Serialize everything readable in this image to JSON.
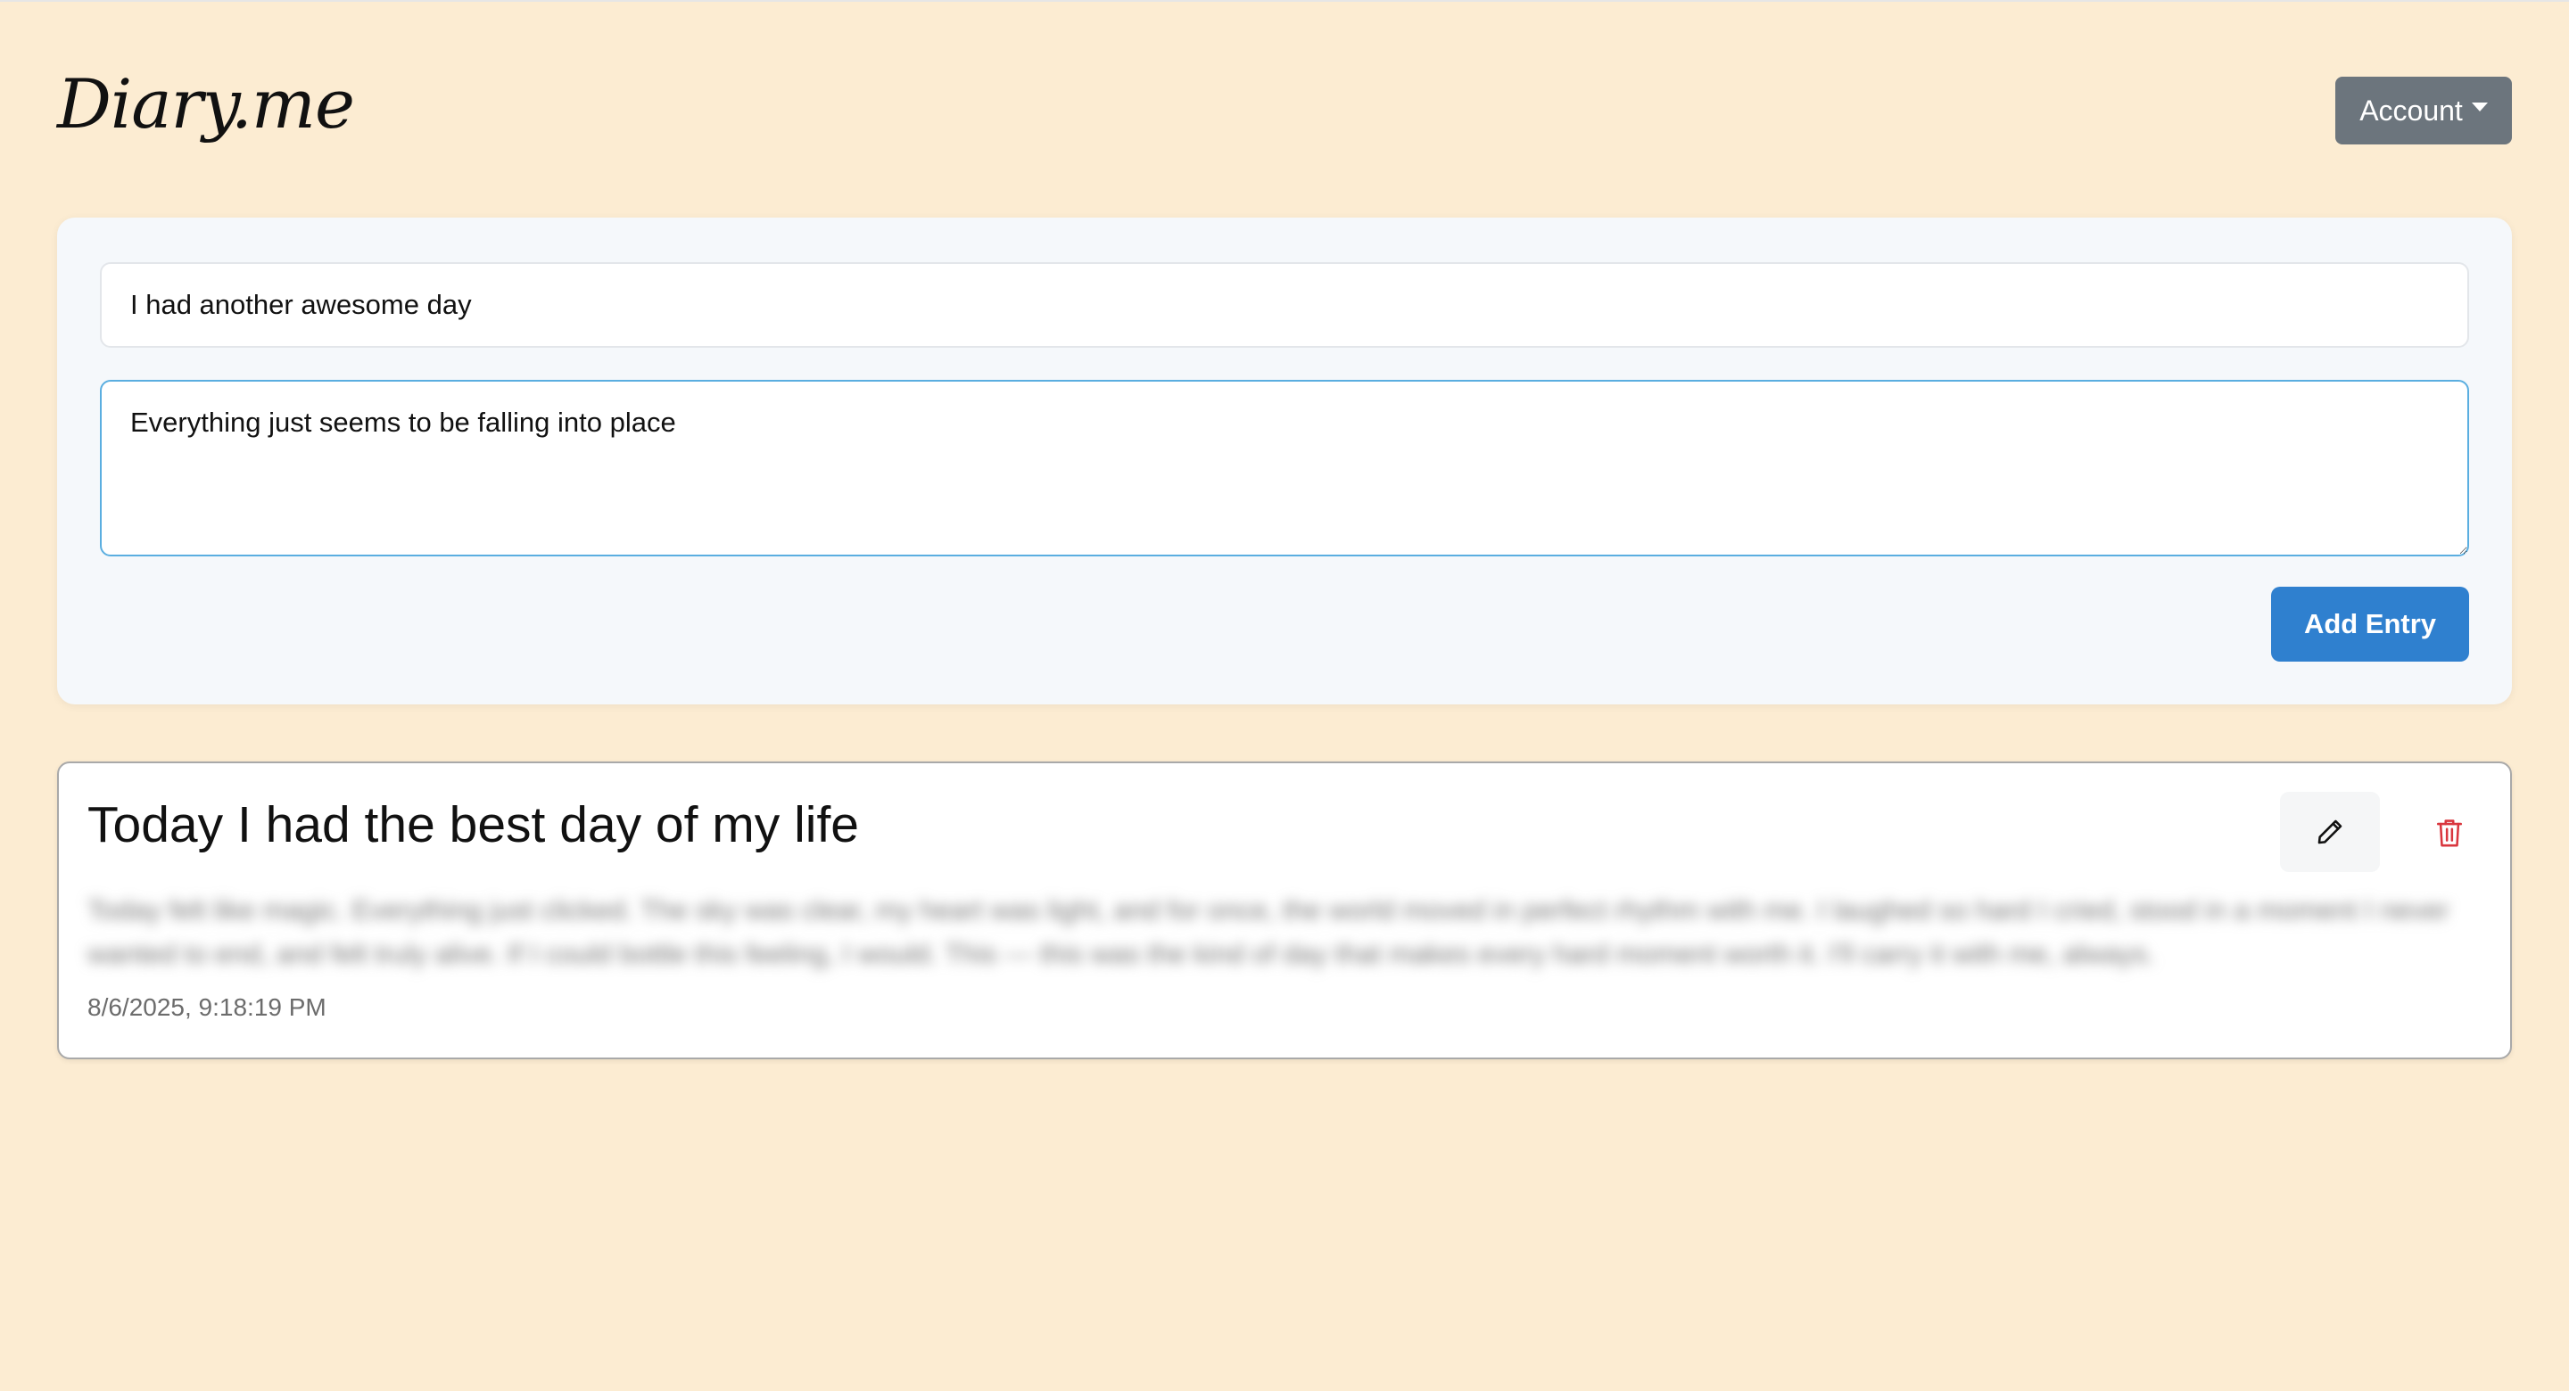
{
  "header": {
    "brand": "Diary.me",
    "account_label": "Account"
  },
  "form": {
    "title_value": "I had another awesome day",
    "body_value": "Everything just seems to be falling into place",
    "add_label": "Add Entry"
  },
  "entries": [
    {
      "title": "Today I had the best day of my life",
      "body": "Today felt like magic. Everything just clicked. The sky was clear, my heart was light, and for once, the world moved in perfect rhythm with me. I laughed so hard I cried, stood in a moment I never wanted to end, and felt truly alive. If I could bottle this feeling, I would. This — this was the kind of day that makes every hard moment worth it. I'll carry it with me, always.",
      "date": "8/6/2025, 9:18:19 PM",
      "edit_icon": "pencil-icon",
      "delete_icon": "trash-icon"
    }
  ],
  "colors": {
    "background": "#fcecd2",
    "account_button": "#6c757d",
    "add_button": "#2f80cf",
    "delete_icon": "#d9363e"
  }
}
